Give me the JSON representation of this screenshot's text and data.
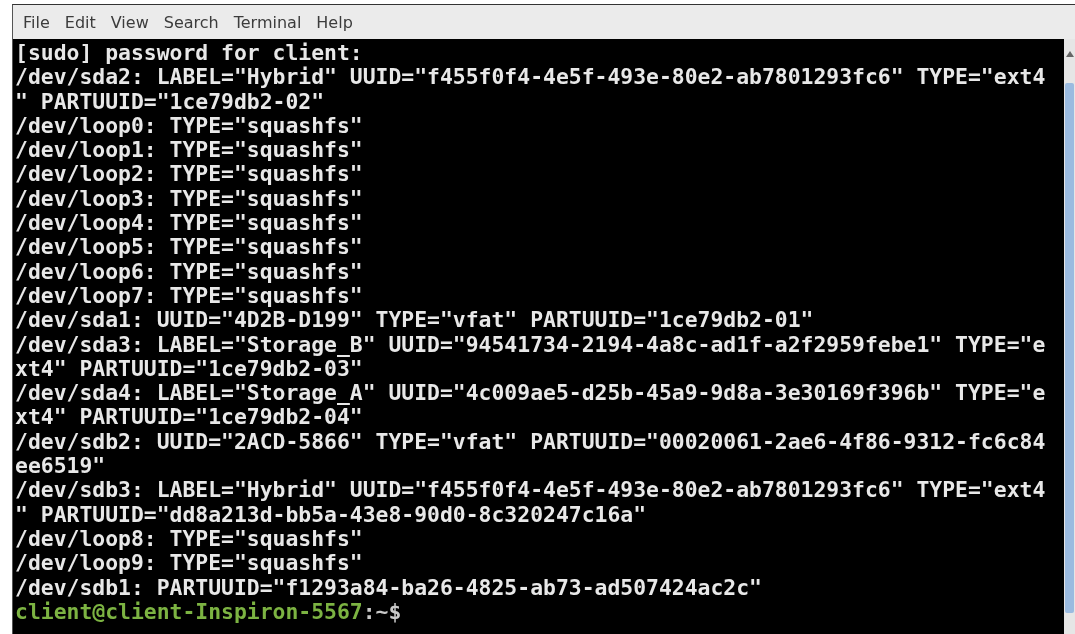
{
  "menu_bar": [
    "File",
    "Edit",
    "View",
    "Search",
    "Terminal",
    "Help"
  ],
  "terminal_lines": [
    {
      "kind": "output",
      "text": "[sudo] password for client:"
    },
    {
      "kind": "output",
      "text": "/dev/sda2: LABEL=\"Hybrid\" UUID=\"f455f0f4-4e5f-493e-80e2-ab7801293fc6\" TYPE=\"ext4"
    },
    {
      "kind": "output",
      "text": "\" PARTUUID=\"1ce79db2-02\""
    },
    {
      "kind": "output",
      "text": "/dev/loop0: TYPE=\"squashfs\""
    },
    {
      "kind": "output",
      "text": "/dev/loop1: TYPE=\"squashfs\""
    },
    {
      "kind": "output",
      "text": "/dev/loop2: TYPE=\"squashfs\""
    },
    {
      "kind": "output",
      "text": "/dev/loop3: TYPE=\"squashfs\""
    },
    {
      "kind": "output",
      "text": "/dev/loop4: TYPE=\"squashfs\""
    },
    {
      "kind": "output",
      "text": "/dev/loop5: TYPE=\"squashfs\""
    },
    {
      "kind": "output",
      "text": "/dev/loop6: TYPE=\"squashfs\""
    },
    {
      "kind": "output",
      "text": "/dev/loop7: TYPE=\"squashfs\""
    },
    {
      "kind": "output",
      "text": "/dev/sda1: UUID=\"4D2B-D199\" TYPE=\"vfat\" PARTUUID=\"1ce79db2-01\""
    },
    {
      "kind": "output",
      "text": "/dev/sda3: LABEL=\"Storage_B\" UUID=\"94541734-2194-4a8c-ad1f-a2f2959febe1\" TYPE=\"e"
    },
    {
      "kind": "output",
      "text": "xt4\" PARTUUID=\"1ce79db2-03\""
    },
    {
      "kind": "output",
      "text": "/dev/sda4: LABEL=\"Storage_A\" UUID=\"4c009ae5-d25b-45a9-9d8a-3e30169f396b\" TYPE=\"e"
    },
    {
      "kind": "output",
      "text": "xt4\" PARTUUID=\"1ce79db2-04\""
    },
    {
      "kind": "output",
      "text": "/dev/sdb2: UUID=\"2ACD-5866\" TYPE=\"vfat\" PARTUUID=\"00020061-2ae6-4f86-9312-fc6c84"
    },
    {
      "kind": "output",
      "text": "ee6519\""
    },
    {
      "kind": "output",
      "text": "/dev/sdb3: LABEL=\"Hybrid\" UUID=\"f455f0f4-4e5f-493e-80e2-ab7801293fc6\" TYPE=\"ext4"
    },
    {
      "kind": "output",
      "text": "\" PARTUUID=\"dd8a213d-bb5a-43e8-90d0-8c320247c16a\""
    },
    {
      "kind": "output",
      "text": "/dev/loop8: TYPE=\"squashfs\""
    },
    {
      "kind": "output",
      "text": "/dev/loop9: TYPE=\"squashfs\""
    },
    {
      "kind": "output",
      "text": "/dev/sdb1: PARTUUID=\"f1293a84-ba26-4825-ab73-ad507424ac2c\""
    },
    {
      "kind": "prompt",
      "user_host": "client@client-Inspiron-5567",
      "suffix": ":~$"
    }
  ]
}
